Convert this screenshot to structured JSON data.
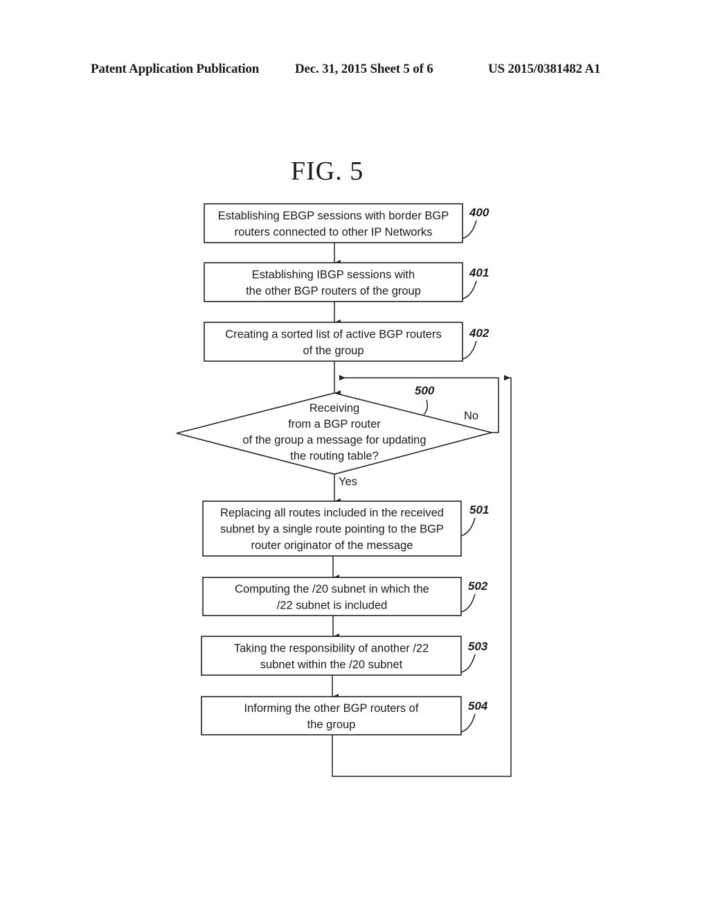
{
  "header": {
    "publication": "Patent Application Publication",
    "date_sheet": "Dec. 31, 2015   Sheet 5 of 6",
    "number": "US 2015/0381482 A1"
  },
  "figure": {
    "title": "FIG. 5"
  },
  "steps": [
    {
      "ref": "400",
      "lines": [
        "Establishing EBGP sessions with border BGP",
        "routers connected to other IP Networks"
      ]
    },
    {
      "ref": "401",
      "lines": [
        "Establishing IBGP sessions with",
        "the other BGP routers of the group"
      ]
    },
    {
      "ref": "402",
      "lines": [
        "Creating a sorted list of active BGP routers",
        "of the group"
      ]
    },
    {
      "ref": "501",
      "lines": [
        "Replacing all routes included in the received",
        "subnet by a single route pointing to the BGP",
        "router originator of the message"
      ]
    },
    {
      "ref": "502",
      "lines": [
        "Computing the /20 subnet in which the",
        "/22 subnet is included"
      ]
    },
    {
      "ref": "503",
      "lines": [
        "Taking the responsibility of another /22",
        "subnet within the /20 subnet"
      ]
    },
    {
      "ref": "504",
      "lines": [
        "Informing the other BGP routers of",
        "the group"
      ]
    }
  ],
  "decision": {
    "ref": "500",
    "lines": [
      "Receiving",
      "from a BGP router",
      "of the group a message for updating",
      "the routing table?"
    ],
    "yes_label": "Yes",
    "no_label": "No"
  }
}
